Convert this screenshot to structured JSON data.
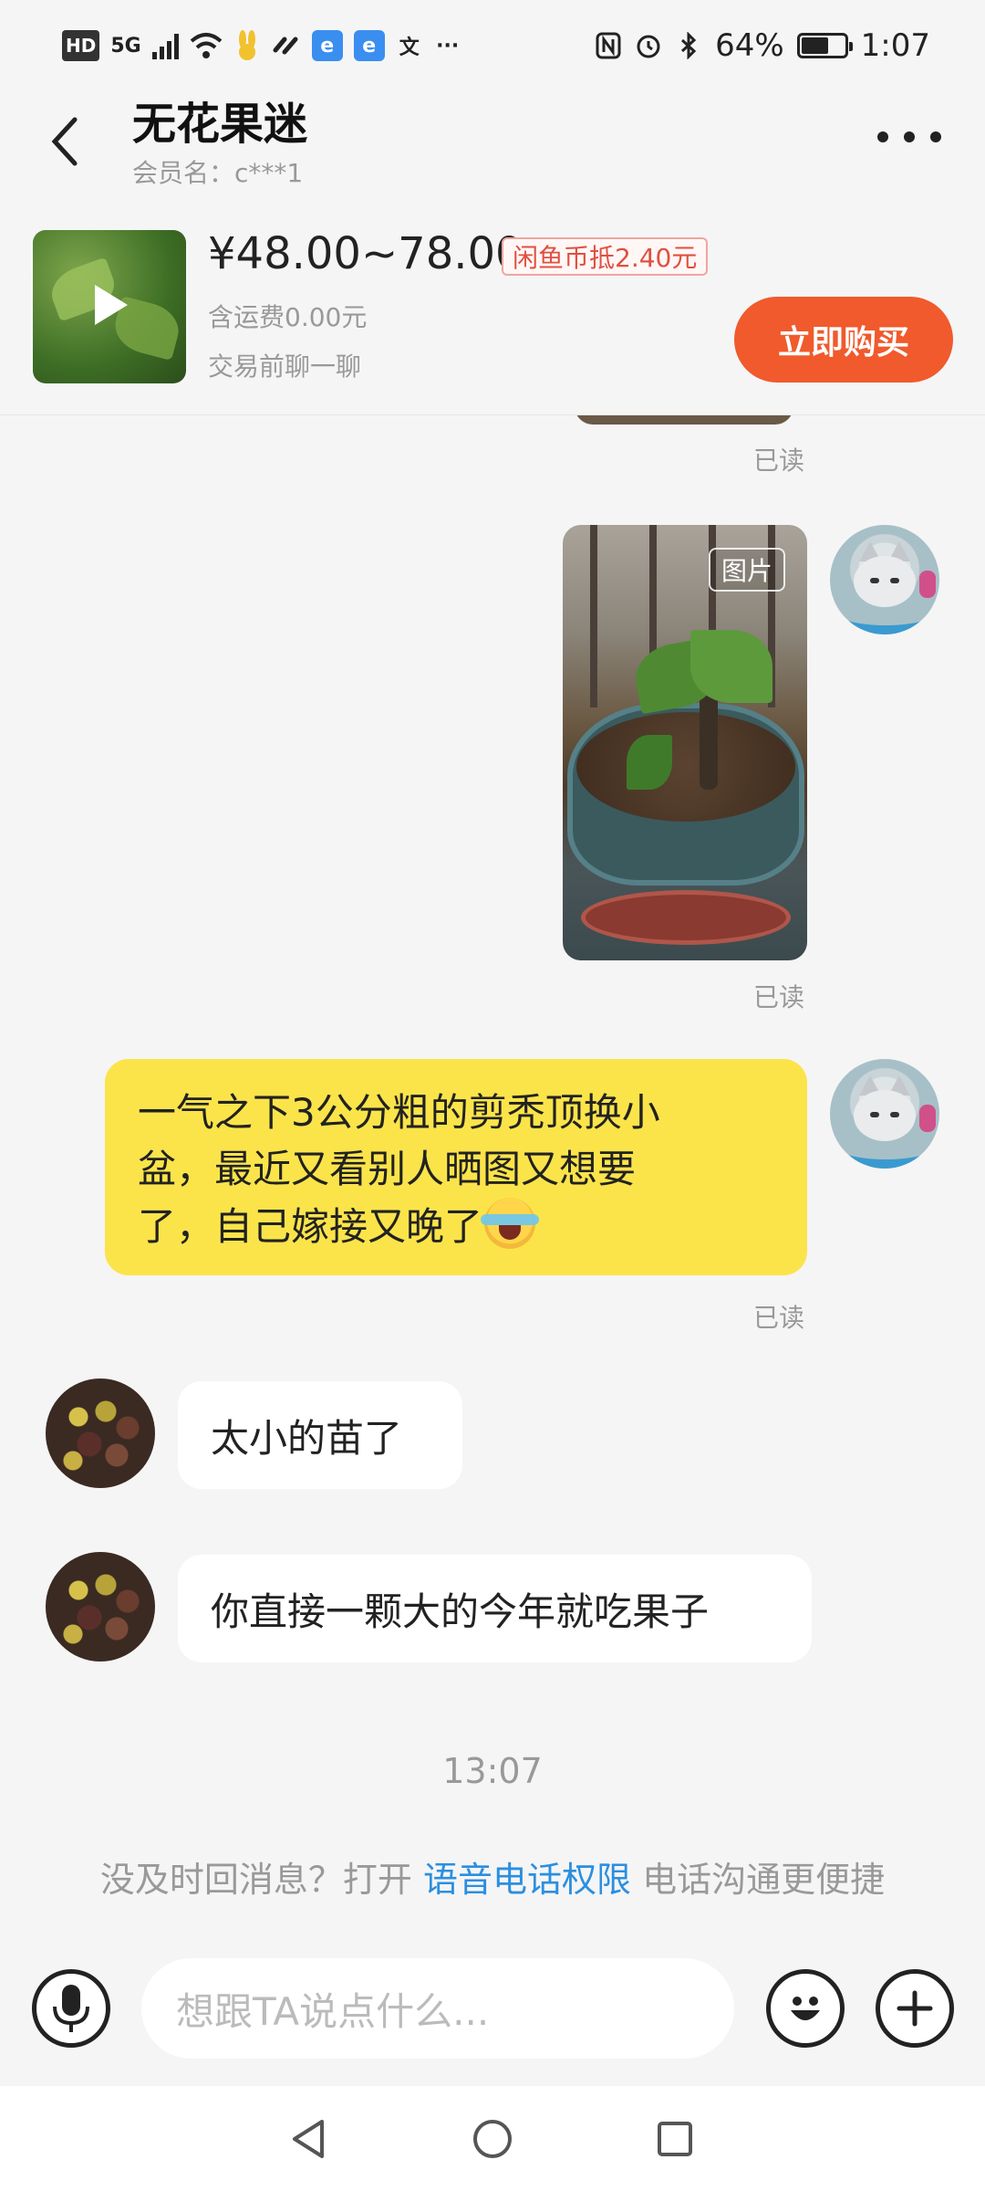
{
  "status_bar": {
    "left_icons": [
      "hd-icon",
      "5g-signal-icon",
      "signal-bars-icon",
      "wifi-icon",
      "bunny-app-icon",
      "link-icon",
      "app-e-icon",
      "app-e-icon",
      "translate-icon",
      "more-dots"
    ],
    "hd": "HD",
    "fiveg": "5G",
    "translate_glyph": "文",
    "dots": "···",
    "battery_percent_text": "64%",
    "battery_level": 0.64,
    "time": "1:07"
  },
  "header": {
    "title": "无花果迷",
    "subtitle": "会员名：c***1"
  },
  "product": {
    "price": "¥48.00~78.00",
    "coin_badge": "闲鱼币抵2.40元",
    "shipping": "含运费0.00元",
    "chat_hint": "交易前聊一聊",
    "buy_label": "立即购买"
  },
  "messages": {
    "read_label": "已读",
    "photo_label": "图片",
    "my_text_line1": "一气之下3公分粗的剪秃顶换小",
    "my_text_line2": "盆，最近又看别人晒图又想要",
    "my_text_line3": "了，自己嫁接又晚了",
    "reply1": "太小的苗了",
    "reply2": "你直接一颗大的今年就吃果子",
    "timestamp": "13:07"
  },
  "permission_tip": {
    "before": "没及时回消息？打开 ",
    "link": "语音电话权限",
    "after": " 电话沟通更便捷"
  },
  "input": {
    "placeholder": "想跟TA说点什么..."
  },
  "colors": {
    "accent_orange": "#f05a2c",
    "bubble_yellow": "#fbe44a",
    "link_blue": "#2b8fe0",
    "background": "#f5f5f5"
  }
}
